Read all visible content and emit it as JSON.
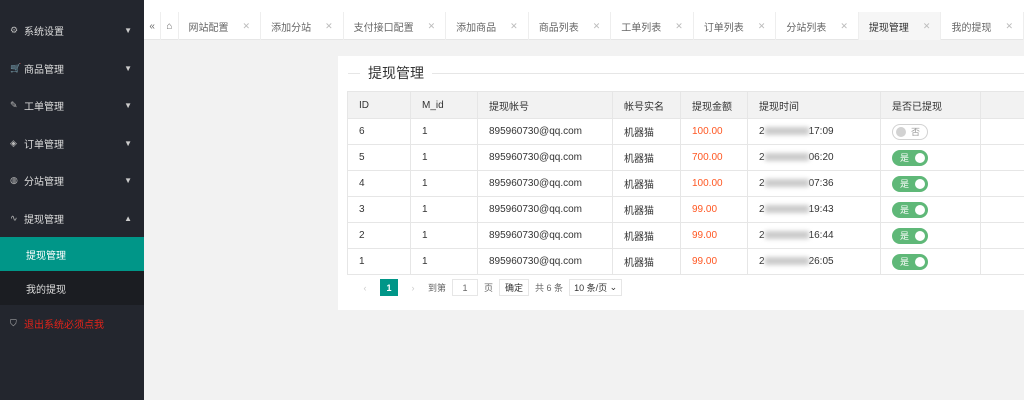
{
  "sidebar": {
    "items": [
      {
        "label": "系统设置",
        "icon": "gear-icon"
      },
      {
        "label": "商品管理",
        "icon": "cart-icon"
      },
      {
        "label": "工单管理",
        "icon": "edit-icon"
      },
      {
        "label": "订单管理",
        "icon": "layers-icon"
      },
      {
        "label": "分站管理",
        "icon": "globe-icon"
      },
      {
        "label": "提现管理",
        "icon": "pulse-icon"
      }
    ],
    "sub": [
      "提现管理",
      "我的提现"
    ],
    "logout": "退出系统必须点我"
  },
  "tabs": [
    "网站配置",
    "添加分站",
    "支付接口配置",
    "添加商品",
    "商品列表",
    "工单列表",
    "订单列表",
    "分站列表",
    "提现管理",
    "我的提现"
  ],
  "active_tab": "提现管理",
  "page_title": "提现管理",
  "table": {
    "headers": [
      "ID",
      "M_id",
      "提现帐号",
      "帐号实名",
      "提现金额",
      "提现时间",
      "是否已提现"
    ],
    "rows": [
      [
        "6",
        "1",
        "895960730@qq.com",
        "机器猫",
        "100.00",
        "2",
        "17:09",
        "否"
      ],
      [
        "5",
        "1",
        "895960730@qq.com",
        "机器猫",
        "700.00",
        "2",
        "06:20",
        "是"
      ],
      [
        "4",
        "1",
        "895960730@qq.com",
        "机器猫",
        "100.00",
        "2",
        "07:36",
        "是"
      ],
      [
        "3",
        "1",
        "895960730@qq.com",
        "机器猫",
        "99.00",
        "2",
        "19:43",
        "是"
      ],
      [
        "2",
        "1",
        "895960730@qq.com",
        "机器猫",
        "99.00",
        "2",
        "16:44",
        "是"
      ],
      [
        "1",
        "1",
        "895960730@qq.com",
        "机器猫",
        "99.00",
        "2",
        "26:05",
        "是"
      ]
    ]
  },
  "pager": {
    "current": "1",
    "goto_label": "到第",
    "page_value": "1",
    "page_label": "页",
    "confirm": "确定",
    "total": "共 6 条",
    "per_page": "10 条/页"
  }
}
